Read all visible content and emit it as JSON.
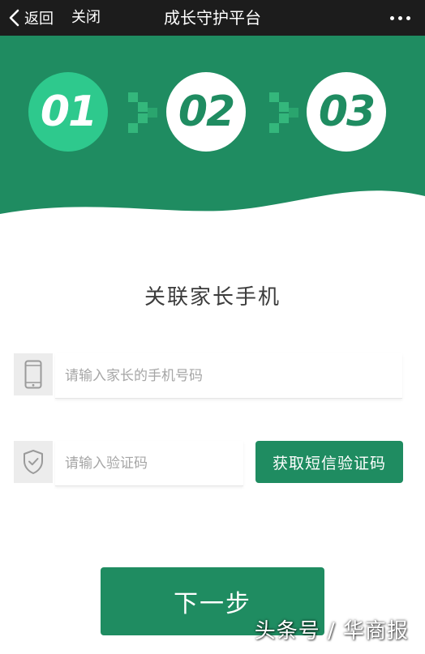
{
  "navbar": {
    "back_label": "返回",
    "close_label": "关闭",
    "title": "成长守护平台"
  },
  "steps": {
    "current": 1,
    "items": [
      "01",
      "02",
      "03"
    ]
  },
  "form": {
    "title": "关联家长手机",
    "phone_placeholder": "请输入家长的手机号码",
    "code_placeholder": "请输入验证码",
    "sms_button_label": "获取短信验证码",
    "next_button_label": "下一步"
  },
  "watermark": "头条号 / 华商报",
  "colors": {
    "brand_green": "#1f8c61",
    "active_step": "#2ec98d",
    "navbar": "#1c1c1c"
  }
}
